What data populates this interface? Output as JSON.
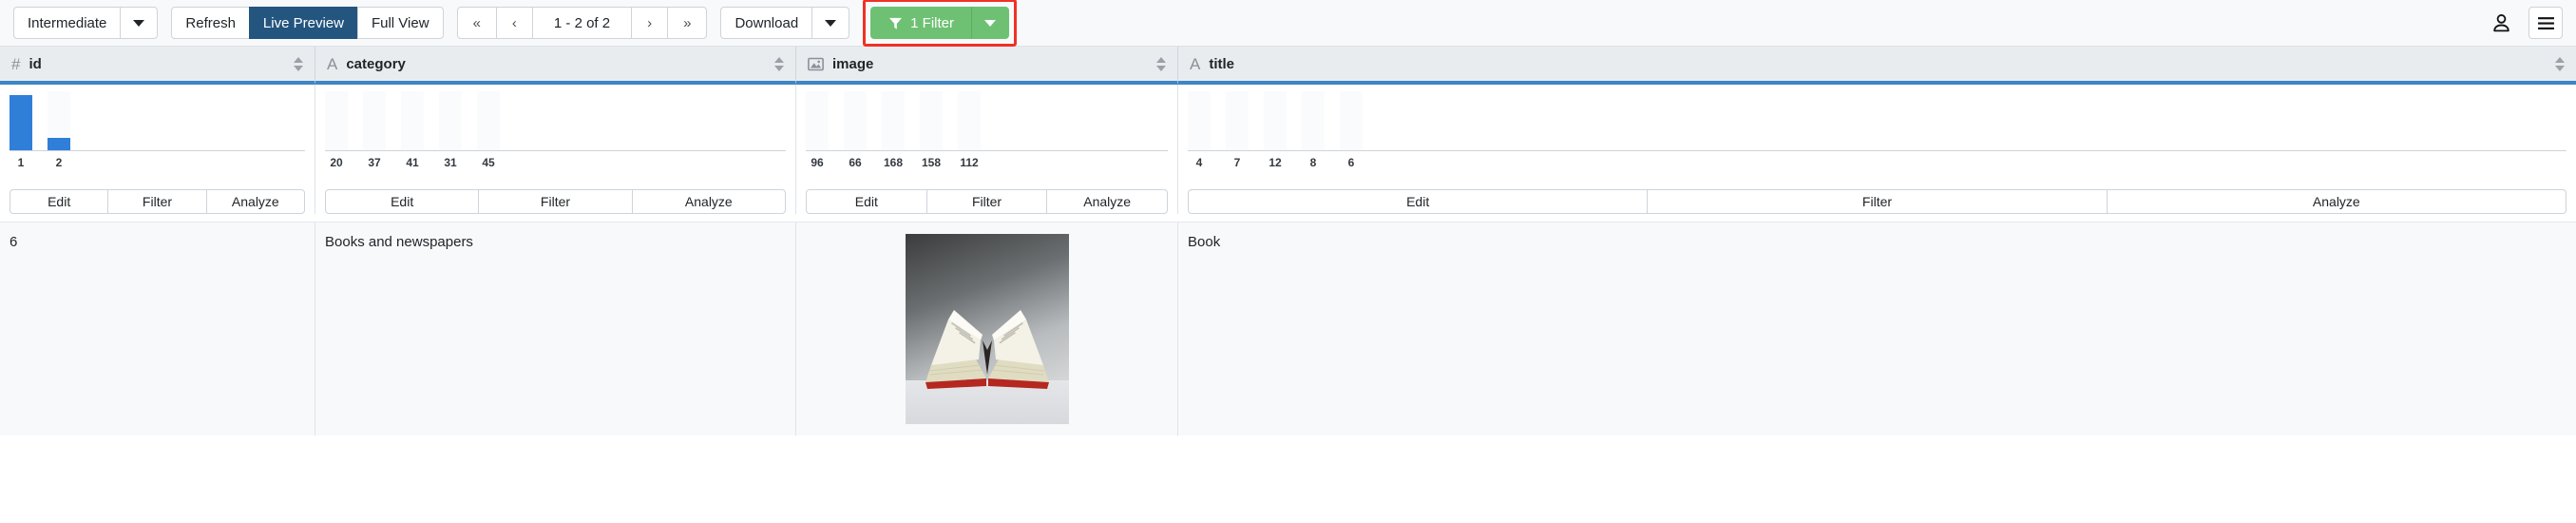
{
  "toolbar": {
    "level_select": {
      "label": "Intermediate",
      "caret_icon": "chevron-down-icon"
    },
    "refresh_label": "Refresh",
    "live_preview_label": "Live Preview",
    "full_view_label": "Full View",
    "pagination": {
      "first_label": "«",
      "prev_label": "‹",
      "range_label": "1 - 2 of 2",
      "next_label": "›",
      "last_label": "»"
    },
    "download_label": "Download",
    "download_caret_icon": "chevron-down-icon",
    "filter": {
      "label": "1 Filter",
      "funnel_icon": "filter-funnel-icon",
      "caret_icon": "chevron-down-icon",
      "accent_color": "#6ec173",
      "highlight_color": "#f03124"
    },
    "account_icon": "user-account-icon",
    "menu_icon": "hamburger-menu-icon",
    "active_color": "#24557f"
  },
  "columns": [
    {
      "name": "id",
      "type_icon": "#",
      "type_glyph": "hash-icon",
      "sort_icon": "sort-updown-icon",
      "actions": {
        "edit": "Edit",
        "filter": "Filter",
        "analyze": "Analyze"
      },
      "chart_data": {
        "type": "bar",
        "categories": [
          "1",
          "2"
        ],
        "values": [
          9,
          2
        ],
        "bar_color": "#2f7ed8",
        "title": "",
        "xlabel": "",
        "ylabel": "",
        "grid": false
      }
    },
    {
      "name": "category",
      "type_icon": "A",
      "type_glyph": "text-letter-icon",
      "sort_icon": "sort-updown-icon",
      "actions": {
        "edit": "Edit",
        "filter": "Filter",
        "analyze": "Analyze"
      },
      "chart_data": {
        "type": "bar",
        "categories": [
          "20",
          "37",
          "41",
          "31",
          "45"
        ],
        "values": [
          0,
          0,
          0,
          0,
          0
        ],
        "bar_color": "#2f7ed8",
        "title": "",
        "xlabel": "",
        "ylabel": "",
        "grid": false
      }
    },
    {
      "name": "image",
      "type_icon": "Ὓc",
      "type_glyph": "picture-icon",
      "sort_icon": "sort-updown-icon",
      "actions": {
        "edit": "Edit",
        "filter": "Filter",
        "analyze": "Analyze"
      },
      "chart_data": {
        "type": "bar",
        "categories": [
          "96",
          "66",
          "168",
          "158",
          "112"
        ],
        "values": [
          0,
          0,
          0,
          0,
          0
        ],
        "bar_color": "#2f7ed8",
        "title": "",
        "xlabel": "",
        "ylabel": "",
        "grid": false
      }
    },
    {
      "name": "title",
      "type_icon": "A",
      "type_glyph": "text-letter-icon",
      "sort_icon": "sort-updown-icon",
      "actions": {
        "edit": "Edit",
        "filter": "Filter",
        "analyze": "Analyze"
      },
      "chart_data": {
        "type": "bar",
        "categories": [
          "4",
          "7",
          "12",
          "8",
          "6"
        ],
        "values": [
          0,
          0,
          0,
          0,
          0
        ],
        "bar_color": "#2f7ed8",
        "title": "",
        "xlabel": "",
        "ylabel": "",
        "grid": false
      }
    }
  ],
  "rows": [
    {
      "id": "6",
      "category": "Books and newspapers",
      "image_alt": "open-book-photo",
      "title": "Book"
    }
  ]
}
